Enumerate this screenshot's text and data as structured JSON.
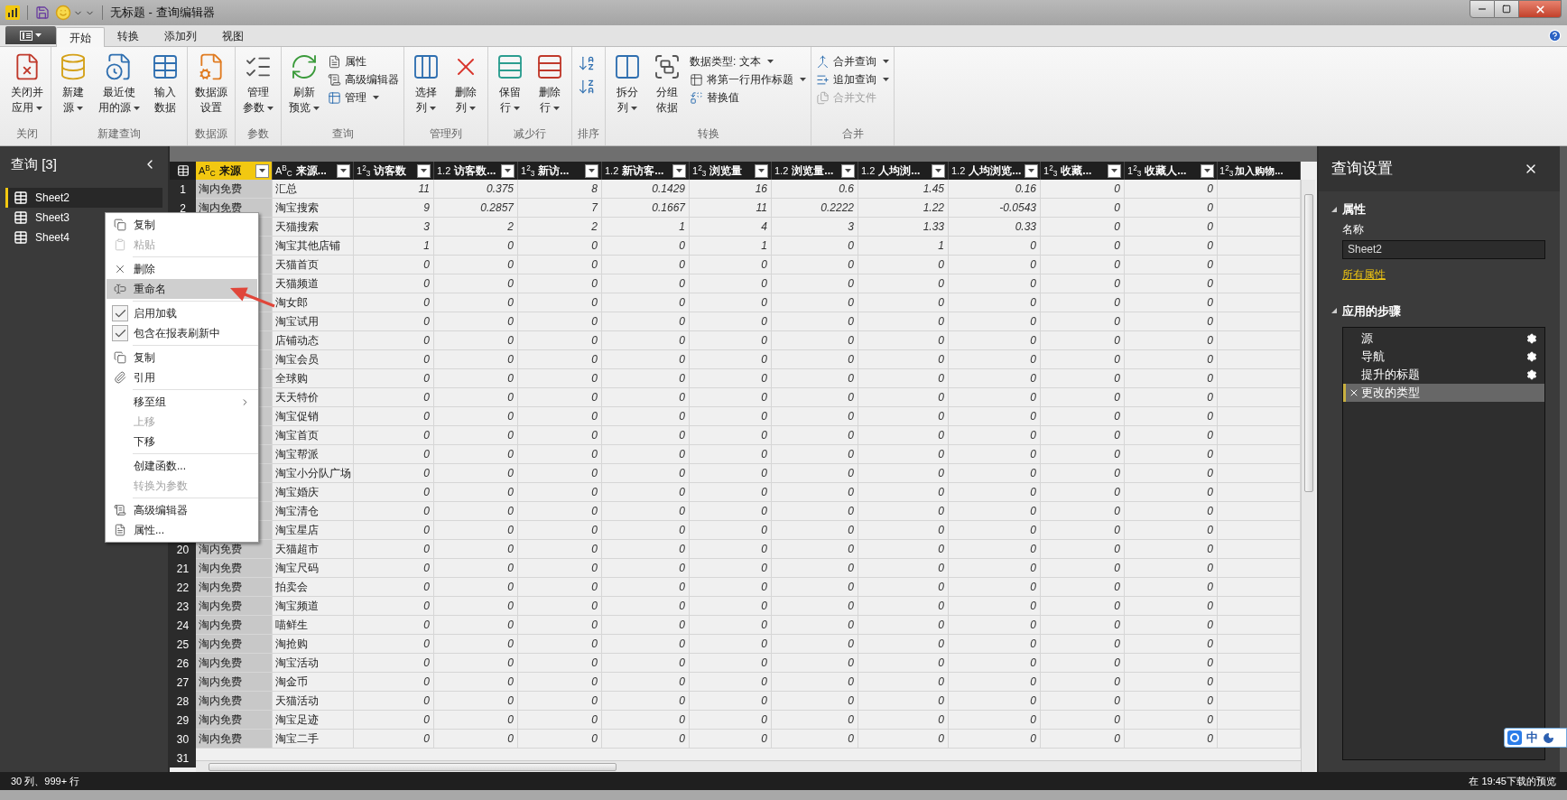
{
  "window": {
    "title": "无标题 - 查询编辑器"
  },
  "tabs": [
    {
      "label": "开始",
      "selected": true
    },
    {
      "label": "转换",
      "selected": false
    },
    {
      "label": "添加列",
      "selected": false
    },
    {
      "label": "视图",
      "selected": false
    }
  ],
  "ribbon": [
    {
      "label": "关闭",
      "kind": "buttons",
      "items": [
        {
          "kind": "large",
          "lines": [
            "关闭并",
            "应用"
          ],
          "dropdown": true,
          "disabled": false
        }
      ]
    },
    {
      "label": "新建查询",
      "kind": "buttons",
      "items": [
        {
          "kind": "large",
          "lines": [
            "新建",
            "源"
          ],
          "dropdown": true,
          "disabled": false
        },
        {
          "kind": "large",
          "lines": [
            "最近使",
            "用的源"
          ],
          "dropdown": true,
          "disabled": false
        },
        {
          "kind": "large",
          "lines": [
            "输入",
            "数据"
          ],
          "dropdown": false,
          "disabled": false
        }
      ]
    },
    {
      "label": "数据源",
      "kind": "buttons",
      "items": [
        {
          "kind": "large",
          "lines": [
            "数据源",
            "设置"
          ],
          "dropdown": false,
          "disabled": false
        }
      ]
    },
    {
      "label": "参数",
      "kind": "buttons",
      "items": [
        {
          "kind": "large",
          "lines": [
            "管理",
            "参数"
          ],
          "dropdown": true,
          "disabled": false
        }
      ]
    },
    {
      "label": "查询",
      "kind": "buttons",
      "items": [
        {
          "kind": "large",
          "lines": [
            "刷新",
            "预览"
          ],
          "dropdown": true,
          "disabled": false
        },
        {
          "kind": "small",
          "lines": [
            "属性"
          ],
          "dropdown": false,
          "disabled": false
        },
        {
          "kind": "small",
          "lines": [
            "高级编辑器"
          ],
          "dropdown": false,
          "disabled": false
        },
        {
          "kind": "small",
          "lines": [
            "管理"
          ],
          "dropdown": true,
          "disabled": false
        }
      ]
    },
    {
      "label": "管理列",
      "kind": "buttons",
      "items": [
        {
          "kind": "large",
          "lines": [
            "选择",
            "列"
          ],
          "dropdown": true,
          "disabled": false
        },
        {
          "kind": "large",
          "lines": [
            "删除",
            "列"
          ],
          "dropdown": true,
          "disabled": false
        }
      ]
    },
    {
      "label": "减少行",
      "kind": "buttons",
      "items": [
        {
          "kind": "large",
          "lines": [
            "保留",
            "行"
          ],
          "dropdown": true,
          "disabled": false
        },
        {
          "kind": "large",
          "lines": [
            "删除",
            "行"
          ],
          "dropdown": true,
          "disabled": false
        }
      ]
    },
    {
      "label": "排序",
      "kind": "sort"
    },
    {
      "label": "转换",
      "kind": "buttons",
      "items": [
        {
          "kind": "large",
          "lines": [
            "拆分",
            "列"
          ],
          "dropdown": true,
          "disabled": false
        },
        {
          "kind": "large",
          "lines": [
            "分组",
            "依据"
          ],
          "dropdown": false,
          "disabled": false
        },
        {
          "kind": "small",
          "lines": [
            "数据类型: 文本"
          ],
          "dropdown": true,
          "disabled": false
        },
        {
          "kind": "small",
          "lines": [
            "将第一行用作标题"
          ],
          "dropdown": true,
          "disabled": false
        },
        {
          "kind": "small",
          "lines": [
            "替换值"
          ],
          "dropdown": false,
          "disabled": false
        }
      ]
    },
    {
      "label": "合并",
      "kind": "buttons",
      "items": [
        {
          "kind": "small",
          "lines": [
            "合并查询"
          ],
          "dropdown": true,
          "disabled": false
        },
        {
          "kind": "small",
          "lines": [
            "追加查询"
          ],
          "dropdown": true,
          "disabled": false
        },
        {
          "kind": "small",
          "lines": [
            "合并文件"
          ],
          "dropdown": false,
          "disabled": true
        }
      ]
    }
  ],
  "queries": {
    "title": "查询 [3]",
    "items": [
      {
        "label": "Sheet2",
        "selected": true
      },
      {
        "label": "Sheet3",
        "selected": false
      },
      {
        "label": "Sheet4",
        "selected": false
      }
    ]
  },
  "context_menu": [
    {
      "kind": "item",
      "label": "复制",
      "disabled": false,
      "highlighted": false
    },
    {
      "kind": "item",
      "label": "粘贴",
      "disabled": true,
      "highlighted": false
    },
    {
      "kind": "separator"
    },
    {
      "kind": "item",
      "label": "删除",
      "disabled": false,
      "highlighted": false
    },
    {
      "kind": "item",
      "label": "重命名",
      "disabled": false,
      "highlighted": true
    },
    {
      "kind": "separator"
    },
    {
      "kind": "check",
      "label": "启用加载",
      "checked": true,
      "disabled": false,
      "highlighted": false
    },
    {
      "kind": "check",
      "label": "包含在报表刷新中",
      "checked": true,
      "disabled": false,
      "highlighted": false
    },
    {
      "kind": "separator"
    },
    {
      "kind": "item",
      "label": "复制",
      "disabled": false,
      "highlighted": false
    },
    {
      "kind": "item",
      "label": "引用",
      "disabled": false,
      "highlighted": false
    },
    {
      "kind": "separator"
    },
    {
      "kind": "submenu",
      "label": "移至组",
      "disabled": false,
      "highlighted": false
    },
    {
      "kind": "item",
      "label": "上移",
      "disabled": true,
      "highlighted": false
    },
    {
      "kind": "item",
      "label": "下移",
      "disabled": false,
      "highlighted": false
    },
    {
      "kind": "separator"
    },
    {
      "kind": "item",
      "label": "创建函数...",
      "disabled": false,
      "highlighted": false
    },
    {
      "kind": "item",
      "label": "转换为参数",
      "disabled": true,
      "highlighted": false
    },
    {
      "kind": "separator"
    },
    {
      "kind": "item",
      "label": "高级编辑器",
      "disabled": false,
      "highlighted": false
    },
    {
      "kind": "item",
      "label": "属性...",
      "disabled": false,
      "highlighted": false
    }
  ],
  "grid": {
    "columns": [
      {
        "type_label": "A$^{B}$$_{C}$",
        "label": "来源",
        "selected": true
      },
      {
        "type_label": "A$^{B}$$_{C}$",
        "label": "来源...",
        "selected": false
      },
      {
        "type_label": "1$^{2}$$_{3}$",
        "label": "访客数",
        "selected": false
      },
      {
        "type_label": "1.2",
        "label": "访客数...",
        "selected": false
      },
      {
        "type_label": "1$^{2}$$_{3}$",
        "label": "新访...",
        "selected": false
      },
      {
        "type_label": "1.2",
        "label": "新访客...",
        "selected": false
      },
      {
        "type_label": "1$^{2}$$_{3}$",
        "label": "浏览量",
        "selected": false
      },
      {
        "type_label": "1.2",
        "label": "浏览量...",
        "selected": false
      },
      {
        "type_label": "1.2",
        "label": "人均浏...",
        "selected": false
      },
      {
        "type_label": "1.2",
        "label": "人均浏览...",
        "selected": false
      },
      {
        "type_label": "1$^{2}$$_{3}$",
        "label": "收藏...",
        "selected": false
      },
      {
        "type_label": "1$^{2}$$_{3}$",
        "label": "收藏人...",
        "selected": false
      },
      {
        "type_label": "1$^{2}$$_{3}$",
        "label": "加入购物...",
        "selected": false
      }
    ],
    "rows": [
      {
        "number": "1",
        "source": "淘内免费",
        "name": "汇总",
        "values": [
          "11",
          "0.375",
          "8",
          "0.1429",
          "16",
          "0.6",
          "1.45",
          "0.16",
          "0",
          "0"
        ]
      },
      {
        "number": "2",
        "source": "淘内免费",
        "name": "淘宝搜索",
        "values": [
          "9",
          "0.2857",
          "7",
          "0.1667",
          "11",
          "0.2222",
          "1.22",
          "-0.0543",
          "0",
          "0"
        ]
      },
      {
        "name": "天猫搜索",
        "values": [
          "3",
          "2",
          "2",
          "1",
          "4",
          "3",
          "1.33",
          "0.33",
          "0",
          "0"
        ]
      },
      {
        "name": "淘宝其他店铺",
        "values": [
          "1",
          "0",
          "0",
          "0",
          "1",
          "0",
          "1",
          "0",
          "0",
          "0"
        ]
      },
      {
        "name": "天猫首页",
        "values": [
          "0",
          "0",
          "0",
          "0",
          "0",
          "0",
          "0",
          "0",
          "0",
          "0"
        ]
      },
      {
        "name": "天猫频道",
        "values": [
          "0",
          "0",
          "0",
          "0",
          "0",
          "0",
          "0",
          "0",
          "0",
          "0"
        ]
      },
      {
        "name": "淘女郎",
        "values": [
          "0",
          "0",
          "0",
          "0",
          "0",
          "0",
          "0",
          "0",
          "0",
          "0"
        ]
      },
      {
        "name": "淘宝试用",
        "values": [
          "0",
          "0",
          "0",
          "0",
          "0",
          "0",
          "0",
          "0",
          "0",
          "0"
        ]
      },
      {
        "name": "店铺动态",
        "values": [
          "0",
          "0",
          "0",
          "0",
          "0",
          "0",
          "0",
          "0",
          "0",
          "0"
        ]
      },
      {
        "name": "淘宝会员",
        "values": [
          "0",
          "0",
          "0",
          "0",
          "0",
          "0",
          "0",
          "0",
          "0",
          "0"
        ]
      },
      {
        "name": "全球购",
        "values": [
          "0",
          "0",
          "0",
          "0",
          "0",
          "0",
          "0",
          "0",
          "0",
          "0"
        ]
      },
      {
        "name": "天天特价",
        "values": [
          "0",
          "0",
          "0",
          "0",
          "0",
          "0",
          "0",
          "0",
          "0",
          "0"
        ]
      },
      {
        "name": "淘宝促销",
        "values": [
          "0",
          "0",
          "0",
          "0",
          "0",
          "0",
          "0",
          "0",
          "0",
          "0"
        ]
      },
      {
        "name": "淘宝首页",
        "values": [
          "0",
          "0",
          "0",
          "0",
          "0",
          "0",
          "0",
          "0",
          "0",
          "0"
        ]
      },
      {
        "name": "淘宝帮派",
        "values": [
          "0",
          "0",
          "0",
          "0",
          "0",
          "0",
          "0",
          "0",
          "0",
          "0"
        ]
      },
      {
        "name": "淘宝小分队广场",
        "values": [
          "0",
          "0",
          "0",
          "0",
          "0",
          "0",
          "0",
          "0",
          "0",
          "0"
        ]
      },
      {
        "name": "淘宝婚庆",
        "values": [
          "0",
          "0",
          "0",
          "0",
          "0",
          "0",
          "0",
          "0",
          "0",
          "0"
        ]
      },
      {
        "name": "淘宝清仓",
        "values": [
          "0",
          "0",
          "0",
          "0",
          "0",
          "0",
          "0",
          "0",
          "0",
          "0"
        ]
      },
      {
        "name": "淘宝星店",
        "values": [
          "0",
          "0",
          "0",
          "0",
          "0",
          "0",
          "0",
          "0",
          "0",
          "0"
        ]
      },
      {
        "number": "20",
        "source": "淘内免费",
        "name": "天猫超市",
        "values": [
          "0",
          "0",
          "0",
          "0",
          "0",
          "0",
          "0",
          "0",
          "0",
          "0"
        ]
      },
      {
        "number": "21",
        "source": "淘内免费",
        "name": "淘宝尺码",
        "values": [
          "0",
          "0",
          "0",
          "0",
          "0",
          "0",
          "0",
          "0",
          "0",
          "0"
        ]
      },
      {
        "number": "22",
        "source": "淘内免费",
        "name": "拍卖会",
        "values": [
          "0",
          "0",
          "0",
          "0",
          "0",
          "0",
          "0",
          "0",
          "0",
          "0"
        ]
      },
      {
        "number": "23",
        "source": "淘内免费",
        "name": "淘宝频道",
        "values": [
          "0",
          "0",
          "0",
          "0",
          "0",
          "0",
          "0",
          "0",
          "0",
          "0"
        ]
      },
      {
        "number": "24",
        "source": "淘内免费",
        "name": "喵鲜生",
        "values": [
          "0",
          "0",
          "0",
          "0",
          "0",
          "0",
          "0",
          "0",
          "0",
          "0"
        ]
      },
      {
        "number": "25",
        "source": "淘内免费",
        "name": "淘抢购",
        "values": [
          "0",
          "0",
          "0",
          "0",
          "0",
          "0",
          "0",
          "0",
          "0",
          "0"
        ]
      },
      {
        "number": "26",
        "source": "淘内免费",
        "name": "淘宝活动",
        "values": [
          "0",
          "0",
          "0",
          "0",
          "0",
          "0",
          "0",
          "0",
          "0",
          "0"
        ]
      },
      {
        "number": "27",
        "source": "淘内免费",
        "name": "淘金币",
        "values": [
          "0",
          "0",
          "0",
          "0",
          "0",
          "0",
          "0",
          "0",
          "0",
          "0"
        ]
      },
      {
        "number": "28",
        "source": "淘内免费",
        "name": "天猫活动",
        "values": [
          "0",
          "0",
          "0",
          "0",
          "0",
          "0",
          "0",
          "0",
          "0",
          "0"
        ]
      },
      {
        "number": "29",
        "source": "淘内免费",
        "name": "淘宝足迹",
        "values": [
          "0",
          "0",
          "0",
          "0",
          "0",
          "0",
          "0",
          "0",
          "0",
          "0"
        ]
      },
      {
        "number": "30",
        "source": "淘内免费",
        "name": "淘宝二手",
        "values": [
          "0",
          "0",
          "0",
          "0",
          "0",
          "0",
          "0",
          "0",
          "0",
          "0"
        ]
      }
    ],
    "partial_row_number": "31"
  },
  "settings": {
    "title": "查询设置",
    "properties_heading": "属性",
    "name_label": "名称",
    "name_value": "Sheet2",
    "all_properties_link": "所有属性",
    "steps_heading": "应用的步骤",
    "steps": [
      {
        "label": "源",
        "selected": false,
        "has_settings": true
      },
      {
        "label": "导航",
        "selected": false,
        "has_settings": true
      },
      {
        "label": "提升的标题",
        "selected": false,
        "has_settings": true
      },
      {
        "label": "更改的类型",
        "selected": true,
        "has_settings": false
      }
    ]
  },
  "ime_bar": {
    "label": "中"
  },
  "status_bar": {
    "left": "30 列、999+ 行",
    "right": "在 19:45下载的预览"
  }
}
